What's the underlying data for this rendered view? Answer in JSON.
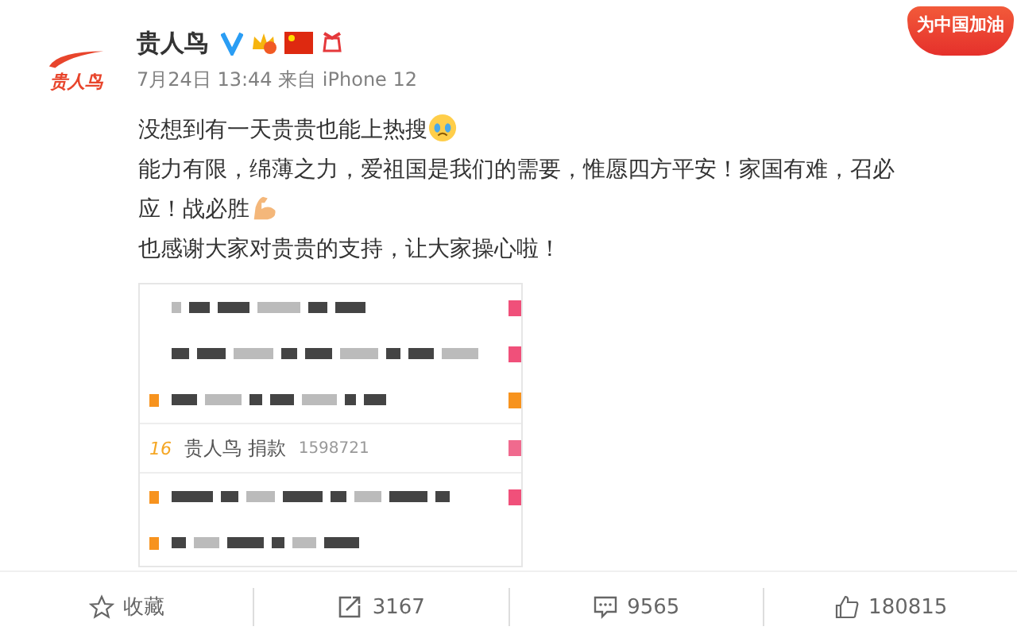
{
  "badge": {
    "label": "为中国加油"
  },
  "post": {
    "author": "贵人鸟",
    "avatar_label": "贵人鸟",
    "meta": "7月24日 13:44 来自 iPhone 12",
    "paragraphs": [
      {
        "kind": "cry",
        "text": "没想到有一天贵贵也能上热搜"
      },
      {
        "kind": "arm",
        "text": "能力有限，绵薄之力，爱祖国是我们的需要，惟愿四方平安！家国有难，召必",
        "continuation": "应！战必胜"
      },
      {
        "kind": "plain",
        "text": "也感谢大家对贵贵的支持，让大家操心啦！"
      }
    ]
  },
  "image": {
    "rows": [
      {
        "kind": "blurred",
        "marker": false,
        "color": "#f0507a"
      },
      {
        "kind": "blurred",
        "marker": false,
        "color": "#f0507a"
      },
      {
        "kind": "blurred",
        "marker": true,
        "color": "#f7931e"
      },
      {
        "kind": "text",
        "rank": "16",
        "title": "贵人鸟 捐款",
        "count": "1598721",
        "color": "#f06a8e"
      },
      {
        "kind": "blurred",
        "marker": true,
        "color": "#f0507a"
      },
      {
        "kind": "blurred",
        "marker": true
      }
    ]
  },
  "actions": [
    {
      "kind": "favorite",
      "label": "收藏"
    },
    {
      "kind": "repost",
      "label": "3167"
    },
    {
      "kind": "comment",
      "label": "9565"
    },
    {
      "kind": "like",
      "label": "180815"
    }
  ]
}
